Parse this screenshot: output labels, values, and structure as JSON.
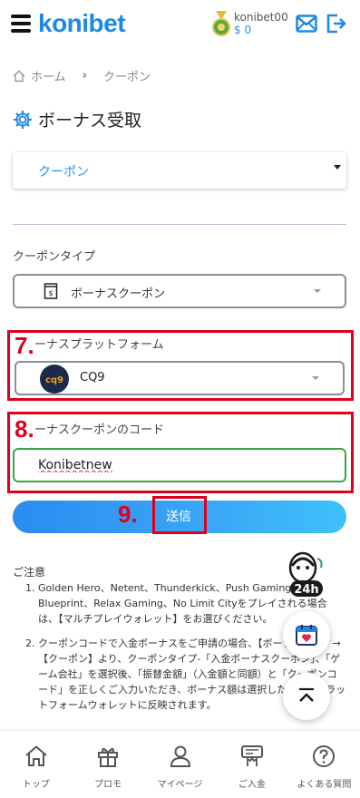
{
  "header": {
    "logo": "konibet",
    "username": "konibet00",
    "balance": "$ 0"
  },
  "breadcrumb": {
    "home": "ホーム",
    "current": "クーポン"
  },
  "page_title": "ボーナス受取",
  "coupon_select": {
    "value": "クーポン"
  },
  "coupon_type": {
    "label": "クーポンタイプ",
    "value": "ボーナスクーポン"
  },
  "platform": {
    "label": "ーナスプラットフォーム",
    "value": "CQ9",
    "logo_text": "cq9"
  },
  "coupon_code": {
    "label": "ーナスクーポンのコード",
    "value": "Konibetnew"
  },
  "submit_label": "送信",
  "annotations": {
    "step7": "7.",
    "step8": "8.",
    "step9": "9."
  },
  "notes": {
    "title": "ご注意",
    "items": [
      "Golden Hero、Netent、Thunderkick、Push Gaming、Blueprint、Relax Gaming、No Limit Cityをプレイされる場合は、【マルチプレイウォレット】をお選びください。",
      "クーポンコードで入金ボーナスをご申請の場合、【ボーナス受取】→【クーポン】より、クーポンタイプ-「入金ボーナスクーポン」、「ゲーム会社」を選択後、「振替金額」（入金額と同額）と「クーポンコード」を正しくご入力いただき、ボーナス額は選択したゲームプラットフォームウォレットに反映されます。"
    ]
  },
  "support_badge": "24h",
  "bottom_nav": [
    {
      "label": "トップ",
      "icon": "home-icon"
    },
    {
      "label": "プロモ",
      "icon": "gift-icon"
    },
    {
      "label": "マイページ",
      "icon": "user-icon"
    },
    {
      "label": "ご入金",
      "icon": "deposit-icon"
    },
    {
      "label": "よくある質問",
      "icon": "help-icon"
    }
  ],
  "colors": {
    "accent": "#2196f3",
    "highlight": "#e0001b",
    "input_ok": "#3fa34d"
  }
}
